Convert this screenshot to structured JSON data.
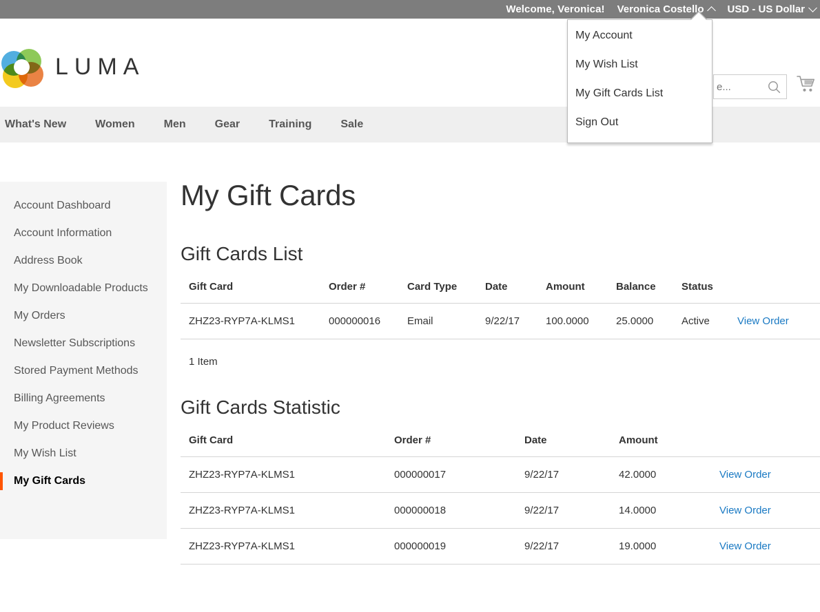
{
  "top_panel": {
    "welcome": "Welcome, Veronica!",
    "customer_name": "Veronica Costello",
    "customer_caret_icon": "chevron-up-icon",
    "currency": "USD - US Dollar",
    "currency_caret_icon": "chevron-down-icon"
  },
  "account_dropdown": {
    "items": [
      {
        "label": "My Account"
      },
      {
        "label": "My Wish List"
      },
      {
        "label": "My Gift Cards List"
      },
      {
        "label": "Sign Out"
      }
    ]
  },
  "header": {
    "logo_text": "LUMA",
    "logo_icon": "luma-flower-logo-icon",
    "search_placeholder": "e...",
    "search_value": "",
    "search_icon": "search-icon",
    "cart_icon": "shopping-cart-icon"
  },
  "nav": {
    "items": [
      {
        "label": "What's New"
      },
      {
        "label": "Women"
      },
      {
        "label": "Men"
      },
      {
        "label": "Gear"
      },
      {
        "label": "Training"
      },
      {
        "label": "Sale"
      }
    ]
  },
  "sidebar": {
    "items": [
      {
        "label": "Account Dashboard",
        "current": false
      },
      {
        "label": "Account Information",
        "current": false
      },
      {
        "label": "Address Book",
        "current": false
      },
      {
        "label": "My Downloadable Products",
        "current": false
      },
      {
        "label": "My Orders",
        "current": false
      },
      {
        "label": "Newsletter Subscriptions",
        "current": false
      },
      {
        "label": "Stored Payment Methods",
        "current": false
      },
      {
        "label": "Billing Agreements",
        "current": false
      },
      {
        "label": "My Product Reviews",
        "current": false
      },
      {
        "label": "My Wish List",
        "current": false
      },
      {
        "label": "My Gift Cards",
        "current": true
      }
    ]
  },
  "main": {
    "page_title": "My Gift Cards",
    "gift_cards_list": {
      "title": "Gift Cards List",
      "columns": [
        "Gift Card",
        "Order #",
        "Card Type",
        "Date",
        "Amount",
        "Balance",
        "Status",
        ""
      ],
      "rows": [
        {
          "gift_card": "ZHZ23-RYP7A-KLMS1",
          "order": "000000016",
          "card_type": "Email",
          "date": "9/22/17",
          "amount": "100.0000",
          "balance": "25.0000",
          "status": "Active",
          "action": "View Order"
        }
      ],
      "toolbar_amount": "1 Item"
    },
    "gift_cards_statistic": {
      "title": "Gift Cards Statistic",
      "columns": [
        "Gift Card",
        "Order #",
        "Date",
        "Amount",
        ""
      ],
      "rows": [
        {
          "gift_card": "ZHZ23-RYP7A-KLMS1",
          "order": "000000017",
          "date": "9/22/17",
          "amount": "42.0000",
          "action": "View Order"
        },
        {
          "gift_card": "ZHZ23-RYP7A-KLMS1",
          "order": "000000018",
          "date": "9/22/17",
          "amount": "14.0000",
          "action": "View Order"
        },
        {
          "gift_card": "ZHZ23-RYP7A-KLMS1",
          "order": "000000019",
          "date": "9/22/17",
          "amount": "19.0000",
          "action": "View Order"
        }
      ]
    }
  },
  "colors": {
    "top_panel_bg": "#7d7d7d",
    "nav_bg": "#efefef",
    "sidebar_bg": "#f5f5f5",
    "accent_orange": "#ff5501",
    "link_blue": "#1979c3",
    "text_dark": "#333333"
  }
}
